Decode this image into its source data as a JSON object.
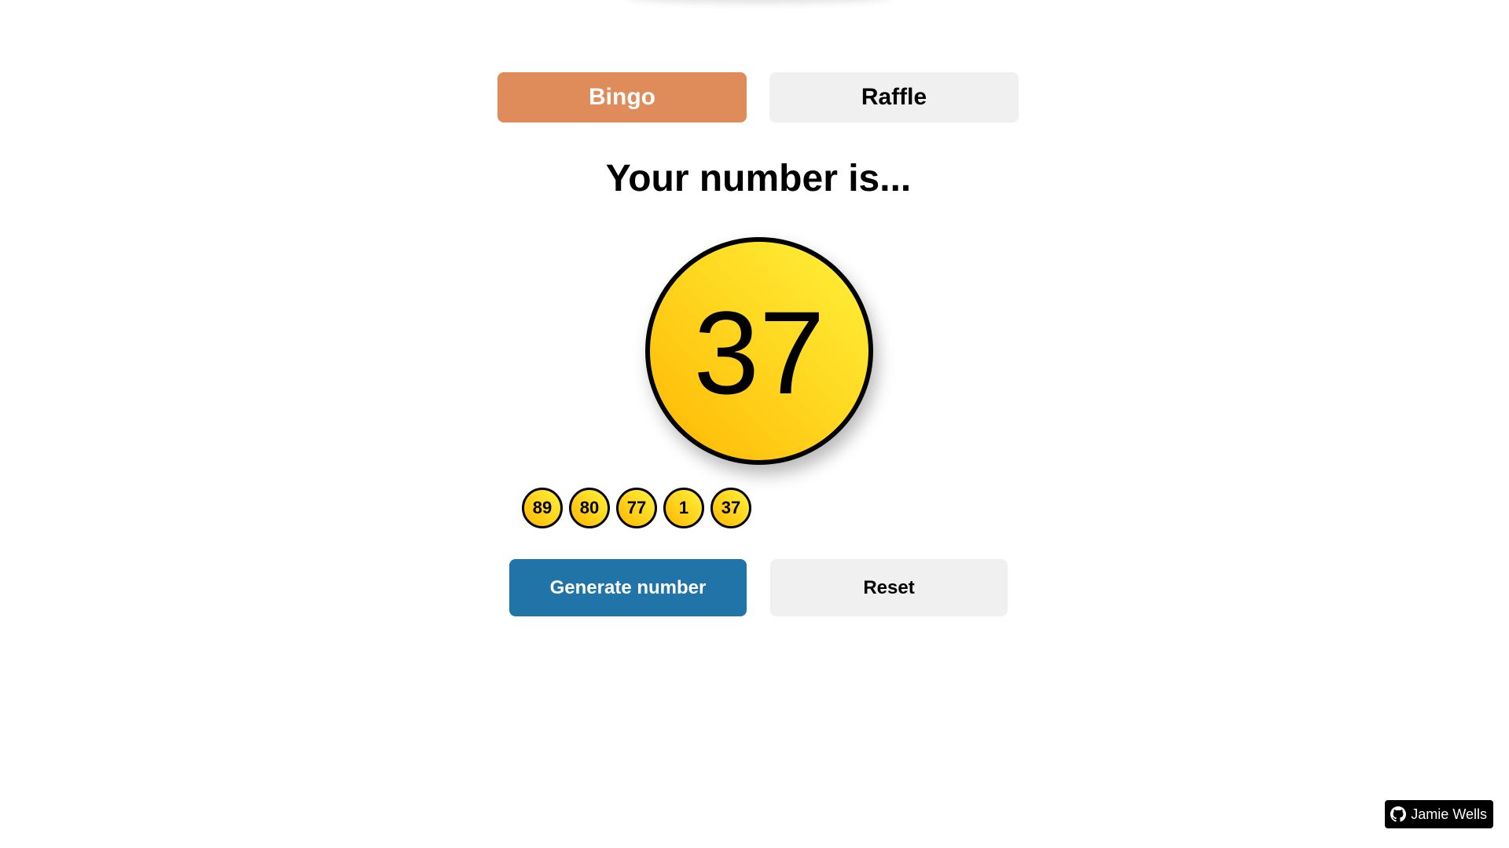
{
  "tabs": {
    "bingo_label": "Bingo",
    "raffle_label": "Raffle",
    "active": "Bingo"
  },
  "heading": "Your number is...",
  "current_number": "37",
  "history": [
    "89",
    "80",
    "77",
    "1",
    "37"
  ],
  "actions": {
    "generate_label": "Generate number",
    "reset_label": "Reset"
  },
  "credit": {
    "icon": "github-icon",
    "label": "Jamie Wells"
  },
  "colors": {
    "tab_active": "#e08b5a",
    "tab_inactive": "#f0f0f0",
    "primary_button": "#2074a8",
    "ball_light": "#fff23a",
    "ball_dark": "#ffb703"
  }
}
